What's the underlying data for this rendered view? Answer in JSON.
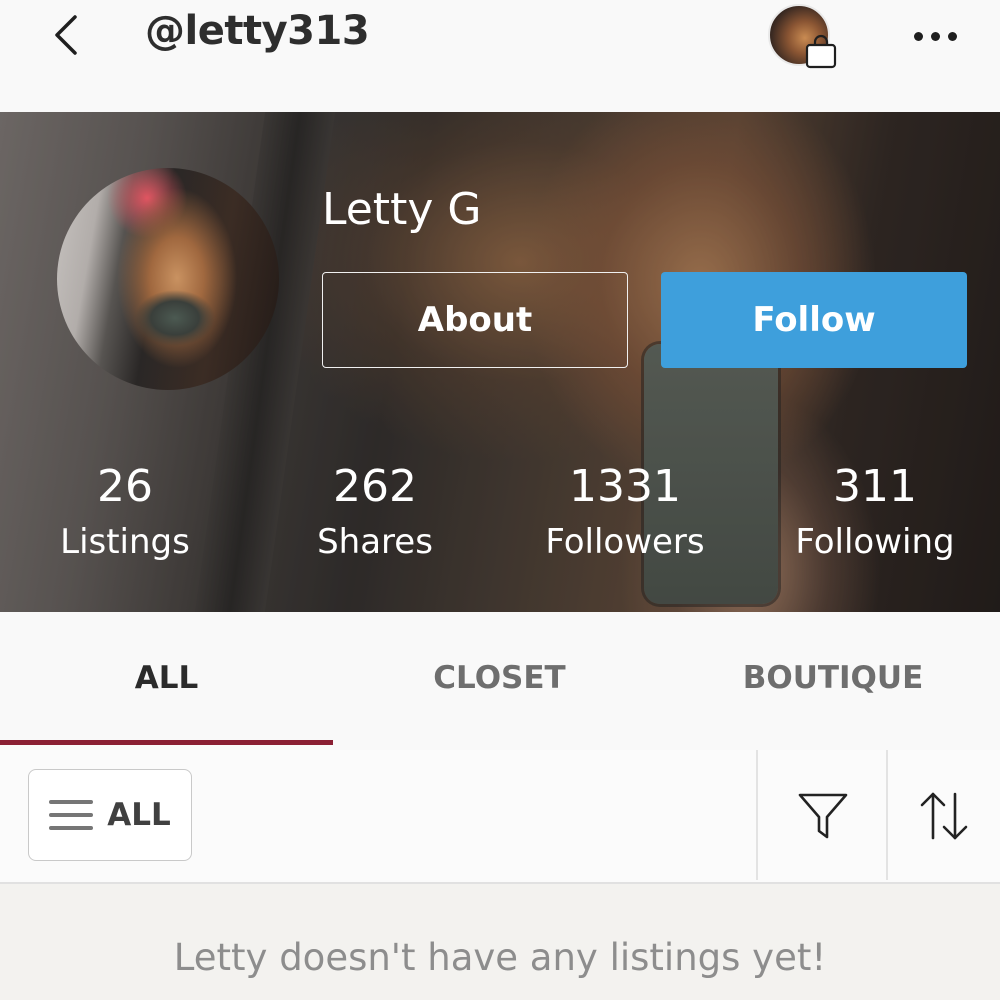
{
  "header": {
    "username": "@letty313",
    "icons": {
      "back": "chevron-left-icon",
      "shop": "shopping-bag-icon",
      "more": "more-horizontal-icon"
    }
  },
  "profile": {
    "display_name": "Letty G",
    "about_label": "About",
    "follow_label": "Follow",
    "follow_color": "#3e9fdc",
    "stats": [
      {
        "value": "26",
        "label": "Listings"
      },
      {
        "value": "262",
        "label": "Shares"
      },
      {
        "value": "1331",
        "label": "Followers"
      },
      {
        "value": "311",
        "label": "Following"
      }
    ]
  },
  "tabs": {
    "items": [
      {
        "label": "ALL",
        "active": true
      },
      {
        "label": "CLOSET",
        "active": false
      },
      {
        "label": "BOUTIQUE",
        "active": false
      }
    ],
    "accent_color": "#8a1f33"
  },
  "filters": {
    "category_label": "ALL",
    "icons": {
      "menu": "hamburger-icon",
      "filter": "funnel-icon",
      "sort": "sort-arrows-icon"
    }
  },
  "empty_state": {
    "message": "Letty doesn't have any listings yet!"
  }
}
